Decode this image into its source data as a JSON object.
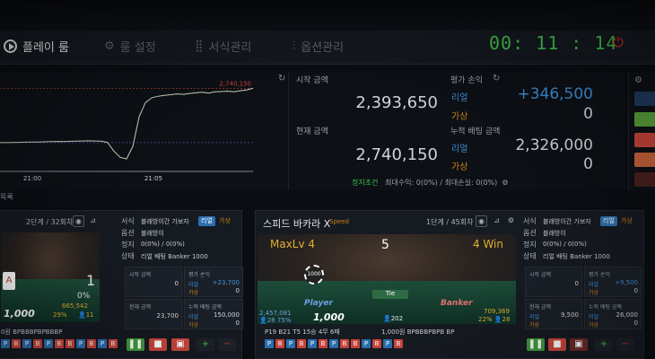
{
  "menu": {
    "play_room": "플레이 룸",
    "room_settings": "룸 설정",
    "format_mgmt": "서식관리",
    "option_mgmt": "옵션관리",
    "timer": "00: 11 : 14"
  },
  "chart_data": {
    "type": "line",
    "x_ticks": [
      "21:00",
      "21:05"
    ],
    "peak_label": "2,740,150",
    "series": [
      {
        "values": [
          2393650,
          2394000,
          2394500,
          2395500,
          2396500,
          2397500,
          2398000,
          2399000,
          2400000,
          2401500,
          2400500,
          2402000,
          2403000,
          2404000,
          2405500,
          2404000,
          2403000,
          2395000,
          2340000,
          2300000,
          2290000,
          2370000,
          2560000,
          2650000,
          2680000,
          2690000,
          2695000,
          2700000,
          2705000,
          2702000,
          2708000,
          2712000,
          2715000,
          2710000,
          2718000,
          2720000,
          2722000,
          2718000,
          2725000,
          2730000,
          2740150
        ]
      }
    ],
    "reference_lines": [
      2740150,
      2393650
    ],
    "grid": false
  },
  "stats": {
    "start_amount_label": "시작 금액",
    "start_amount": "2,393,650",
    "current_amount_label": "현재 금액",
    "current_amount": "2,740,150",
    "eval_pl_label": "평가 손익",
    "real_label": "리얼",
    "fake_label": "가상",
    "eval_real": "+346,500",
    "eval_fake": "0",
    "cum_bet_label": "누적 배팅 금액",
    "cum_real": "2,326,000",
    "cum_fake": "0",
    "stop_label": "정지조건",
    "stop_text": "최대수익: 0(0%) / 최대손실: 0(0%)"
  },
  "sidebar": {
    "colors": [
      "#1e3a5f",
      "#5aa23a",
      "#c8453c",
      "#c9643a",
      "#4a2020"
    ]
  },
  "section": {
    "title": "목록"
  },
  "card_left": {
    "round": "2단계 / 32회차",
    "big_number": "1",
    "percent": "0%",
    "chips": "665,542",
    "pct_a": "29%",
    "cnt_a": "11",
    "stake": "1,000",
    "format_label": "서식",
    "format_value": "블래방이간 가보자",
    "tag_real": "리얼",
    "tag_fake": "가상",
    "option_label": "옵션",
    "option_value": "블래방이",
    "stop_label": "정지",
    "stop_value": "0(0%) / 0(0%)",
    "status_label": "상태",
    "status_value": "리얼 배팅 Banker 1000",
    "start_label": "시작 금액",
    "start_val": "0",
    "eval_label": "평가 손익",
    "real_label": "리얼",
    "fake_label": "가상",
    "eval_real": "+23,700",
    "eval_fake": "0",
    "cur_label": "현재 금액",
    "cur_val": "23,700",
    "cum_label": "누적 배팅 금액",
    "cum_real": "150,000",
    "cum_fake": "0",
    "bead_label": "0원  BPBBBPBPBBBP",
    "beads": [
      "P",
      "B",
      "P",
      "B",
      "P",
      "B",
      "B",
      "P",
      "B",
      "P",
      "B"
    ],
    "card_glyph": "A"
  },
  "card_right": {
    "name": "스피드 바카라 X",
    "name_tag": "Speed",
    "round": "1단계 / 45회차",
    "max_lv": "MaxLv 4",
    "center_num": "5",
    "win": "4 Win",
    "chip_1000": "1000",
    "player_label": "Player",
    "banker_label": "Banker",
    "tie_label": "Tie",
    "p_amount": "2,457,081",
    "p_pct": "28",
    "p_pct2": "75%",
    "b_amount": "709,369",
    "b_pct": "22%",
    "b_cnt": "28",
    "center_cnt": "202",
    "stake": "1,000",
    "format_label": "서식",
    "format_value": "블래방이간 가보자",
    "tag_real": "리얼",
    "tag_fake": "가상",
    "option_label": "옵션",
    "option_value": "블래방이",
    "stop_label": "정지",
    "stop_value": "0(0%) / 0(0%)",
    "status_label": "상태",
    "status_value": "리얼 배팅 Banker 1000",
    "start_label": "시작 금액",
    "start_val": "0",
    "eval_label": "평가 손익",
    "real_label": "리얼",
    "fake_label": "가상",
    "eval_real": "+9,500",
    "eval_fake": "0",
    "cur_label": "현재 금액",
    "cur_val": "9,500",
    "cum_label": "누적 배팅 금액",
    "cum_real": "26,000",
    "cum_fake": "0",
    "stats_line": "P19 B21 T5     15승 4무 6패",
    "bead_label": "1,000원  BPBBBPBPB  BP",
    "beads": [
      "P",
      "B",
      "P",
      "B",
      "P",
      "B",
      "P",
      "B",
      "B",
      "P",
      "B",
      "P",
      "B"
    ]
  }
}
